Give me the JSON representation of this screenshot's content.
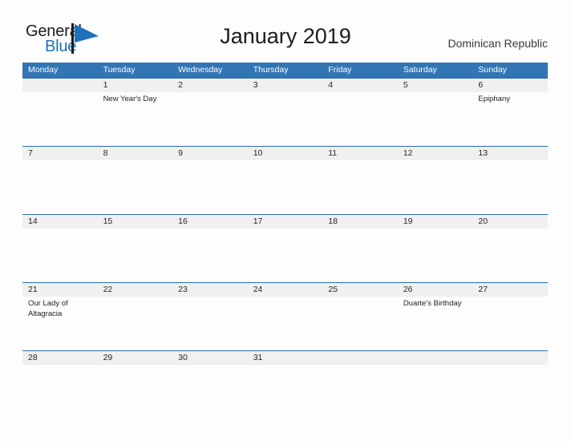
{
  "brand": {
    "name_part1": "General",
    "name_part2": "Blue",
    "flag_icon": "flag-icon",
    "color_dark": "#1c1c1c",
    "color_blue": "#1e72b8"
  },
  "header": {
    "title": "January 2019",
    "region": "Dominican Republic"
  },
  "colors": {
    "header_blue": "#3175b4",
    "row_divider_blue": "#2b6cac",
    "date_band_gray": "#f0f0f0",
    "cell_white": "#fdfdfd",
    "page_background": "#fdfdfd",
    "text_dark": "#1c1c1c"
  },
  "calendar": {
    "month": "January",
    "year": "2019",
    "weekday_headers": [
      "Monday",
      "Tuesday",
      "Wednesday",
      "Thursday",
      "Friday",
      "Saturday",
      "Sunday"
    ],
    "weeks": [
      {
        "days": [
          {
            "date": "",
            "events": []
          },
          {
            "date": "1",
            "events": [
              "New Year's Day"
            ]
          },
          {
            "date": "2",
            "events": []
          },
          {
            "date": "3",
            "events": []
          },
          {
            "date": "4",
            "events": []
          },
          {
            "date": "5",
            "events": []
          },
          {
            "date": "6",
            "events": [
              "Epiphany"
            ]
          }
        ]
      },
      {
        "days": [
          {
            "date": "7",
            "events": []
          },
          {
            "date": "8",
            "events": []
          },
          {
            "date": "9",
            "events": []
          },
          {
            "date": "10",
            "events": []
          },
          {
            "date": "11",
            "events": []
          },
          {
            "date": "12",
            "events": []
          },
          {
            "date": "13",
            "events": []
          }
        ]
      },
      {
        "days": [
          {
            "date": "14",
            "events": []
          },
          {
            "date": "15",
            "events": []
          },
          {
            "date": "16",
            "events": []
          },
          {
            "date": "17",
            "events": []
          },
          {
            "date": "18",
            "events": []
          },
          {
            "date": "19",
            "events": []
          },
          {
            "date": "20",
            "events": []
          }
        ]
      },
      {
        "days": [
          {
            "date": "21",
            "events": [
              "Our Lady of Altagracia"
            ]
          },
          {
            "date": "22",
            "events": []
          },
          {
            "date": "23",
            "events": []
          },
          {
            "date": "24",
            "events": []
          },
          {
            "date": "25",
            "events": []
          },
          {
            "date": "26",
            "events": [
              "Duarte's Birthday"
            ]
          },
          {
            "date": "27",
            "events": []
          }
        ]
      },
      {
        "days": [
          {
            "date": "28",
            "events": []
          },
          {
            "date": "29",
            "events": []
          },
          {
            "date": "30",
            "events": []
          },
          {
            "date": "31",
            "events": []
          },
          {
            "date": "",
            "events": []
          },
          {
            "date": "",
            "events": []
          },
          {
            "date": "",
            "events": []
          }
        ]
      }
    ]
  }
}
